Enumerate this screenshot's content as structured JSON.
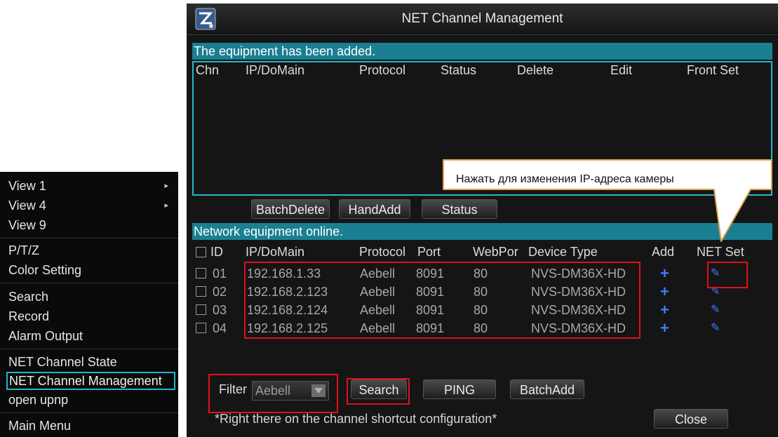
{
  "context_menu": {
    "items": [
      {
        "label": "View 1",
        "submenu": true
      },
      {
        "label": "View 4",
        "submenu": true
      },
      {
        "label": "View 9",
        "submenu": false
      },
      {
        "label": "P/T/Z",
        "submenu": false
      },
      {
        "label": "Color Setting",
        "submenu": false
      },
      {
        "label": "Search",
        "submenu": false
      },
      {
        "label": "Record",
        "submenu": false
      },
      {
        "label": "Alarm Output",
        "submenu": false
      },
      {
        "label": "NET Channel State",
        "submenu": false
      },
      {
        "label": "NET Channel Management",
        "submenu": false,
        "selected": true
      },
      {
        "label": "open upnp",
        "submenu": false
      },
      {
        "label": "Main Menu",
        "submenu": false
      }
    ],
    "submenu_arrow": "▸"
  },
  "dialog": {
    "title": "NET Channel Management",
    "icon": "app-icon",
    "added_section": {
      "heading": "The equipment has been added.",
      "columns": [
        "Chn",
        "IP/DoMain",
        "Protocol",
        "Status",
        "Delete",
        "Edit",
        "Front Set"
      ],
      "rows": []
    },
    "added_buttons": {
      "batch_delete": "BatchDelete",
      "hand_add": "HandAdd",
      "status": "Status"
    },
    "online_section": {
      "heading": "Network equipment online.",
      "columns": [
        "ID",
        "IP/DoMain",
        "Protocol",
        "Port",
        "WebPor",
        "Device Type",
        "Add",
        "NET Set"
      ],
      "rows": [
        {
          "id": "01",
          "ip": "192.168.1.33",
          "protocol": "Aebell",
          "port": "8091",
          "webport": "80",
          "device_type": "NVS-DM36X-HD"
        },
        {
          "id": "02",
          "ip": "192.168.2.123",
          "protocol": "Aebell",
          "port": "8091",
          "webport": "80",
          "device_type": "NVS-DM36X-HD"
        },
        {
          "id": "03",
          "ip": "192.168.2.124",
          "protocol": "Aebell",
          "port": "8091",
          "webport": "80",
          "device_type": "NVS-DM36X-HD"
        },
        {
          "id": "04",
          "ip": "192.168.2.125",
          "protocol": "Aebell",
          "port": "8091",
          "webport": "80",
          "device_type": "NVS-DM36X-HD"
        }
      ],
      "add_glyph": "+",
      "netset_glyph": "✎"
    },
    "filter": {
      "label": "Filter",
      "value": "Aebell"
    },
    "bottom_buttons": {
      "search": "Search",
      "ping": "PING",
      "batch_add": "BatchAdd",
      "close": "Close"
    },
    "hint": "*Right there on the channel shortcut configuration*"
  },
  "callout": {
    "text": "Нажать для изменения IP-адреса камеры"
  },
  "colors": {
    "section_header": "#1a7f91",
    "selected_border": "#19b8c8",
    "annotation_red": "#e0101a",
    "action_blue": "#3d7bff"
  }
}
